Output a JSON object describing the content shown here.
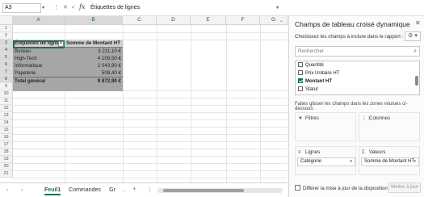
{
  "formula_bar": {
    "name_box": "A3",
    "name_box_arrow": "▾",
    "dots": "⋮",
    "cancel": "✕",
    "enter": "✓",
    "fx": "fx",
    "content": "Étiquettes de lignes",
    "expand": "▾"
  },
  "grid": {
    "columns": [
      "A",
      "B",
      "C",
      "D",
      "E",
      "F",
      "G"
    ],
    "rows": [
      "1",
      "2",
      "3",
      "4",
      "5",
      "6",
      "7",
      "8",
      "9",
      "10",
      "11",
      "12",
      "13",
      "14",
      "15",
      "16",
      "17",
      "18",
      "19",
      "20",
      "21"
    ],
    "expand_cols": "⌄",
    "filter_btn": "▾"
  },
  "pivot": {
    "header_label": "Étiquettes de lignes",
    "header_value": "Somme de Montant HT",
    "rows": [
      {
        "label": "Bureau",
        "value": "3 211,10 €"
      },
      {
        "label": "High-Tech",
        "value": "4 109,50 €"
      },
      {
        "label": "Informatique",
        "value": "2 043,90 €"
      },
      {
        "label": "Papeterie",
        "value": "508,40 €"
      }
    ],
    "total_label": "Total général",
    "total_value": "9 872,90 €"
  },
  "sheets": {
    "nav_prev": "‹",
    "nav_next": "›",
    "tabs": [
      "Feuil1",
      "Commandes",
      "Gr"
    ],
    "more": "…",
    "add": "+",
    "options": "⋮"
  },
  "panel": {
    "title": "Champs de tableau croisé dynamique",
    "close": "✕",
    "subtitle": "Choisissez les champs à inclure dans le rapport :",
    "settings": "⚙ ▾",
    "search_placeholder": "Rechercher",
    "search_icon": "⌕",
    "fields": [
      {
        "label": "Quantité",
        "checked": false
      },
      {
        "label": "Prix Unitaire HT",
        "checked": false
      },
      {
        "label": "Montant HT",
        "checked": true
      },
      {
        "label": "Statut",
        "checked": false
      }
    ],
    "drag_hint": "Faites glisser les champs dans les zones voulues ci-dessous:",
    "zones": {
      "filters": {
        "title": "Filtres",
        "icon": "▼"
      },
      "columns": {
        "title": "Colonnes",
        "icon": "⋮⋮"
      },
      "rows": {
        "title": "Lignes",
        "icon": "≡",
        "field": "Catégorie"
      },
      "values": {
        "title": "Valeurs",
        "icon": "Σ",
        "field": "Somme de Montant HT"
      }
    },
    "zone_arrow": "▾",
    "defer_label": "Différer la mise à jour de la disposition",
    "update_button": "Mettre à jour"
  }
}
